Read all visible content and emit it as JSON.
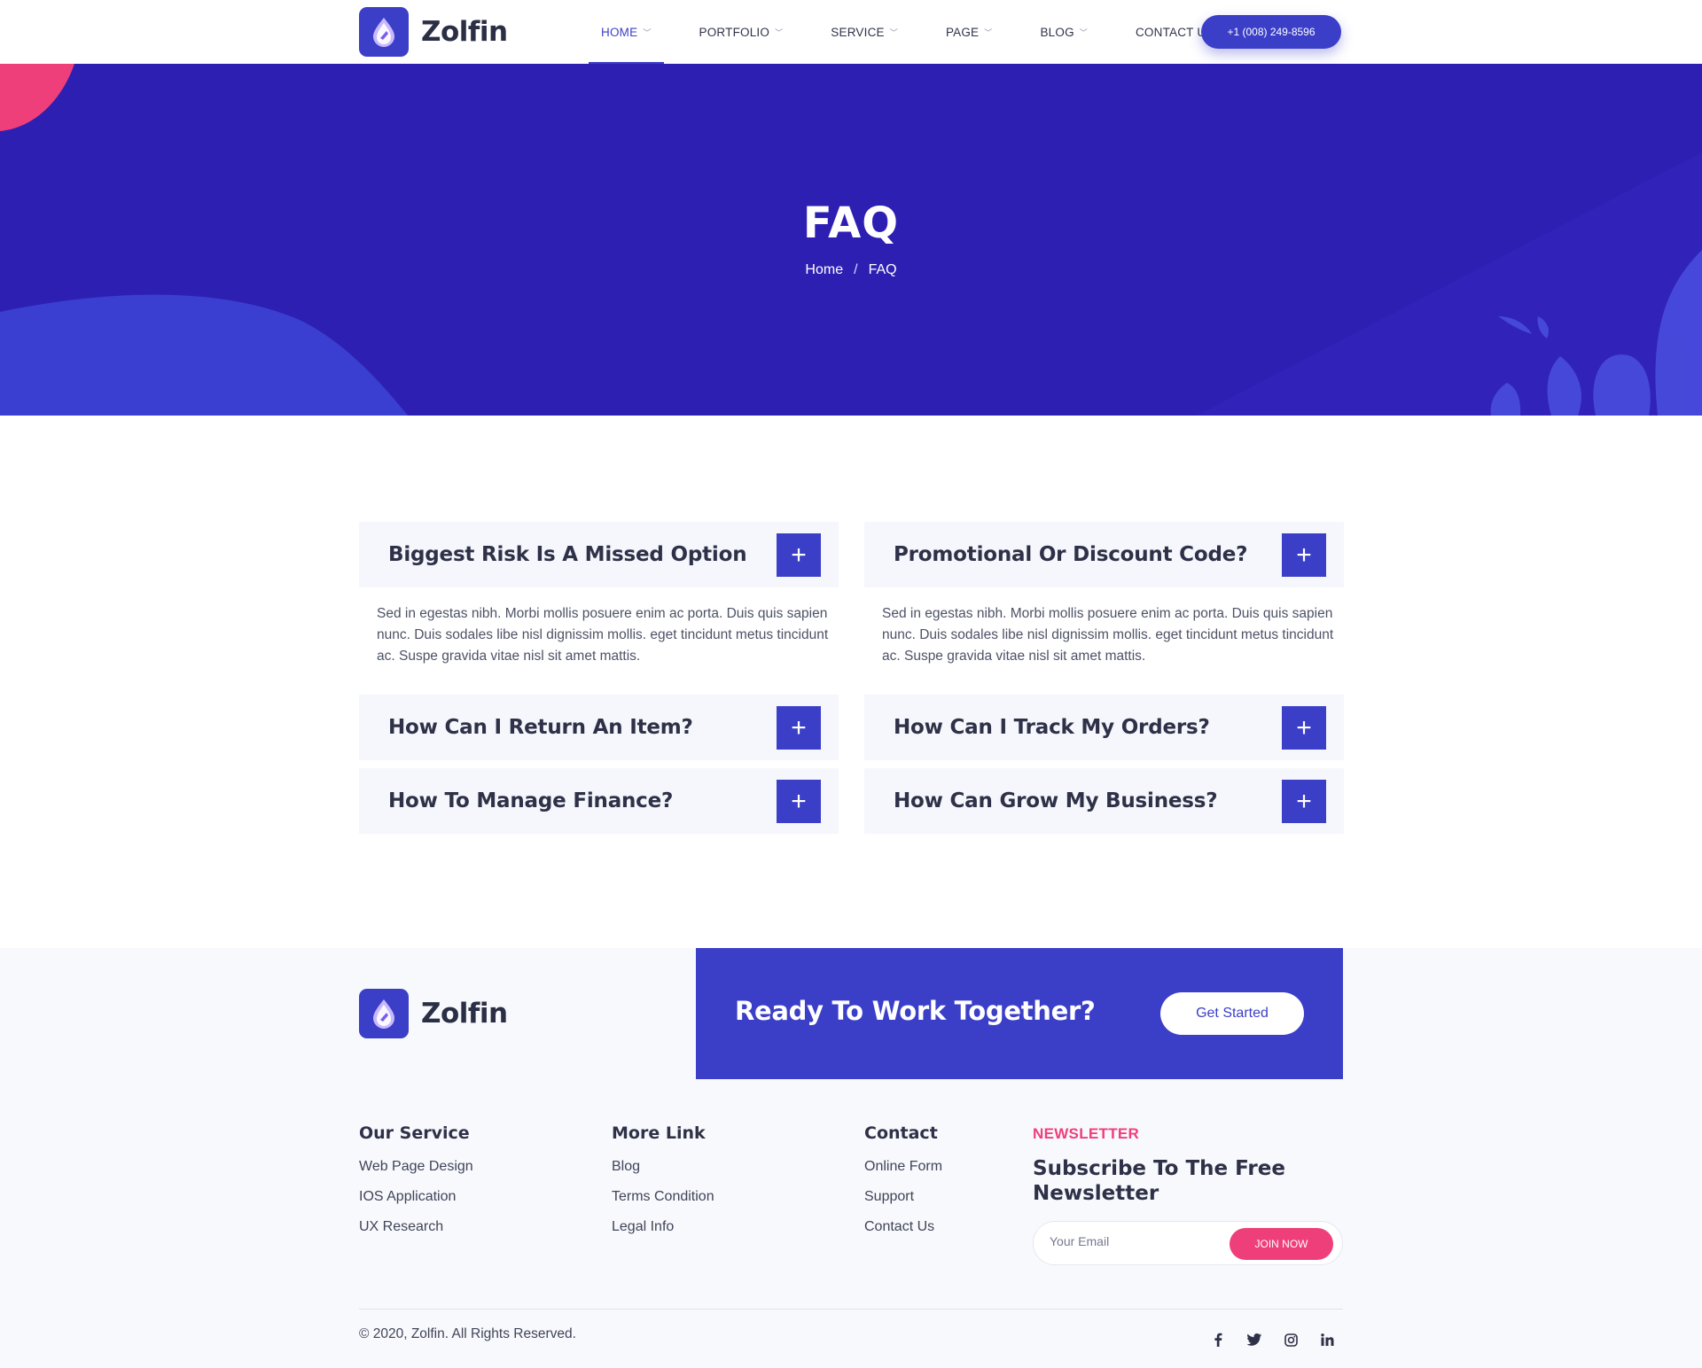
{
  "brand": {
    "name": "Zolfin",
    "colors": {
      "primary": "#3b3fc8",
      "hero": "#2e1fb3",
      "accent": "#ef3f7a"
    }
  },
  "header": {
    "nav": [
      {
        "label": "HOME",
        "has_dropdown": true,
        "active": true
      },
      {
        "label": "PORTFOLIO",
        "has_dropdown": true
      },
      {
        "label": "SERVICE",
        "has_dropdown": true
      },
      {
        "label": "PAGE",
        "has_dropdown": true
      },
      {
        "label": "BLOG",
        "has_dropdown": true
      },
      {
        "label": "CONTACT US",
        "has_dropdown": false
      }
    ],
    "phone": "+1 (008) 249-8596"
  },
  "hero": {
    "title": "FAQ",
    "breadcrumb": {
      "home": "Home",
      "current": "FAQ"
    }
  },
  "faq": {
    "left": [
      {
        "question": "Biggest Risk Is A Missed Option",
        "answer": "Sed in egestas nibh. Morbi mollis posuere enim ac porta. Duis quis sapien nunc. Duis sodales libe nisl dignissim mollis. eget tincidunt metus tincidunt ac. Suspe gravida vitae nisl sit amet mattis."
      },
      {
        "question": "How Can I Return An Item?"
      },
      {
        "question": "How To Manage Finance?"
      }
    ],
    "right": [
      {
        "question": "Promotional Or Discount Code?",
        "answer": "Sed in egestas nibh. Morbi mollis posuere enim ac porta. Duis quis sapien nunc. Duis sodales libe nisl dignissim mollis. eget tincidunt metus tincidunt ac. Suspe gravida vitae nisl sit amet mattis."
      },
      {
        "question": "How Can I Track My Orders?"
      },
      {
        "question": "How Can Grow My Business?"
      }
    ],
    "toggle_icon": "plus-icon"
  },
  "cta": {
    "title": "Ready To Work Together?",
    "button": "Get Started"
  },
  "footer": {
    "service": {
      "heading": "Our Service",
      "links": [
        "Web Page Design",
        "IOS Application",
        "UX Research"
      ]
    },
    "more": {
      "heading": "More Link",
      "links": [
        "Blog",
        "Terms Condition",
        "Legal Info"
      ]
    },
    "contact": {
      "heading": "Contact",
      "links": [
        "Online Form",
        "Support",
        "Contact Us"
      ]
    },
    "newsletter": {
      "tag": "NEWSLETTER",
      "title": "Subscribe To The Free Newsletter",
      "placeholder": "Your Email",
      "button": "JOIN NOW"
    },
    "copyright": "© 2020, Zolfin. All Rights Reserved.",
    "social": [
      {
        "icon": "facebook-icon",
        "glyph": "f"
      },
      {
        "icon": "twitter-icon",
        "glyph": "t"
      },
      {
        "icon": "instagram-icon",
        "glyph": "◎"
      },
      {
        "icon": "linkedin-icon",
        "glyph": "in"
      }
    ]
  }
}
